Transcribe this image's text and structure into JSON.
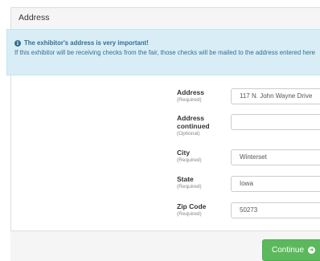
{
  "panel": {
    "title": "Address"
  },
  "alert": {
    "icon": "info-circle-icon",
    "title": "The exhibitor's address is very important!",
    "body": "If this exhibitor will be receiving checks from the fair, those checks will be mailed to the address entered here"
  },
  "fields": {
    "address": {
      "label": "Address",
      "hint": "(Required)",
      "value": "117 N. John Wayne Drive"
    },
    "address2": {
      "label_line1": "Address",
      "label_line2": "continued",
      "hint": "(Optional)",
      "value": ""
    },
    "city": {
      "label": "City",
      "hint": "(Required)",
      "value": "Winterset"
    },
    "state": {
      "label": "State",
      "hint": "(Required)",
      "value": "Iowa"
    },
    "zip": {
      "label": "Zip Code",
      "hint": "(Required)",
      "value": "50273"
    }
  },
  "actions": {
    "continue_label": "Continue",
    "continue_icon": "arrow-right-circle-icon"
  },
  "colors": {
    "alert_bg": "#d9edf7",
    "alert_text": "#31708f",
    "button_bg": "#5cb85c"
  }
}
